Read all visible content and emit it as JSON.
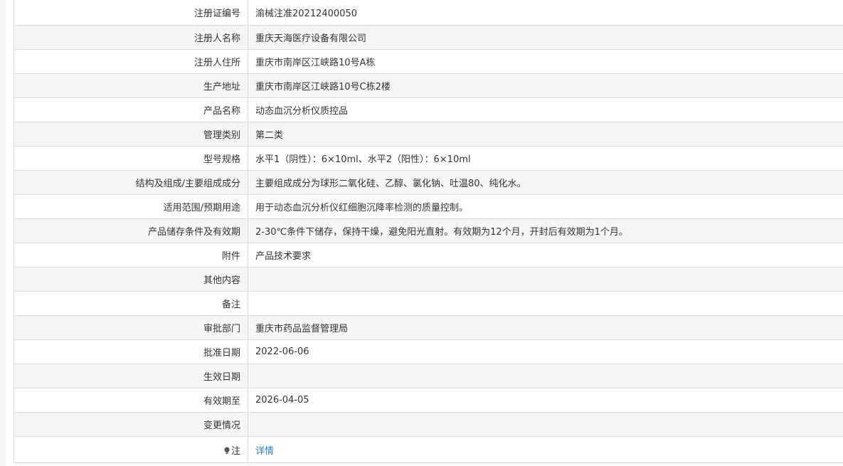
{
  "rows": [
    {
      "label": "注册证编号",
      "value": "渝械注准20212400050"
    },
    {
      "label": "注册人名称",
      "value": "重庆天海医疗设备有限公司"
    },
    {
      "label": "注册人住所",
      "value": "重庆市南岸区江峡路10号A栋"
    },
    {
      "label": "生产地址",
      "value": "重庆市南岸区江峡路10号C栋2楼"
    },
    {
      "label": "产品名称",
      "value": "动态血沉分析仪质控品"
    },
    {
      "label": "管理类别",
      "value": "第二类"
    },
    {
      "label": "型号规格",
      "value": "水平1（阴性）：6×10ml、水平2（阳性）：6×10ml"
    },
    {
      "label": "结构及组成/主要组成成分",
      "value": "主要组成成分为球形二氧化硅、乙醇、氯化钠、吐温80、纯化水。"
    },
    {
      "label": "适用范围/预期用途",
      "value": "用于动态血沉分析仪红细胞沉降率检测的质量控制。"
    },
    {
      "label": "产品储存条件及有效期",
      "value": "2-30℃条件下储存，保持干燥，避免阳光直射。有效期为12个月，开封后有效期为1个月。"
    },
    {
      "label": "附件",
      "value": "产品技术要求"
    },
    {
      "label": "其他内容",
      "value": ""
    },
    {
      "label": "备注",
      "value": ""
    },
    {
      "label": "审批部门",
      "value": "重庆市药品监督管理局"
    },
    {
      "label": "批准日期",
      "value": "2022-06-06"
    },
    {
      "label": "生效日期",
      "value": ""
    },
    {
      "label": "有效期至",
      "value": "2026-04-05"
    },
    {
      "label": "变更情况",
      "value": ""
    }
  ],
  "note": {
    "icon": "lightbulb-icon",
    "label": "注",
    "link_text": "详情",
    "link_color": "#2a7cc7"
  }
}
